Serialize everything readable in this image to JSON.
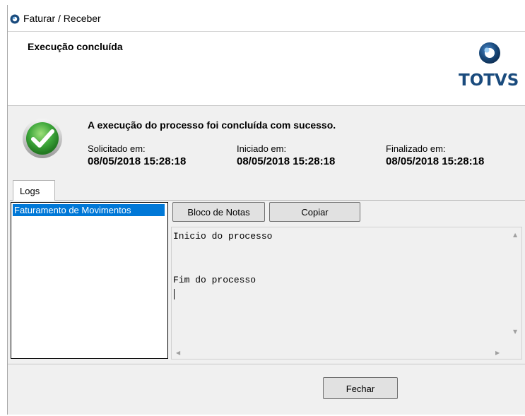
{
  "window": {
    "title": "Faturar / Receber"
  },
  "header": {
    "title": "Execução concluída",
    "logo_text": "TOTVS"
  },
  "status": {
    "message": "A execução do processo foi concluída com sucesso.",
    "solicitado_label": "Solicitado em:",
    "solicitado_value": "08/05/2018 15:28:18",
    "iniciado_label": "Iniciado em:",
    "iniciado_value": "08/05/2018 15:28:18",
    "finalizado_label": "Finalizado em:",
    "finalizado_value": "08/05/2018 15:28:18"
  },
  "tabs": [
    {
      "label": "Logs"
    }
  ],
  "logs": {
    "items": [
      {
        "label": "Faturamento de Movimentos",
        "selected": true
      }
    ],
    "buttons": {
      "notepad": "Bloco de Notas",
      "copy": "Copiar"
    },
    "content": {
      "line1": "Inicio do processo",
      "line2": "Fim do processo"
    }
  },
  "footer": {
    "close_button": "Fechar"
  },
  "colors": {
    "selection": "#0078d7",
    "logo_blue": "#1a4b7d",
    "check_green": "#3da63a"
  },
  "icons": {
    "title": "totvs-app-icon",
    "status": "success-check-icon",
    "logo": "totvs-logo-icon"
  }
}
